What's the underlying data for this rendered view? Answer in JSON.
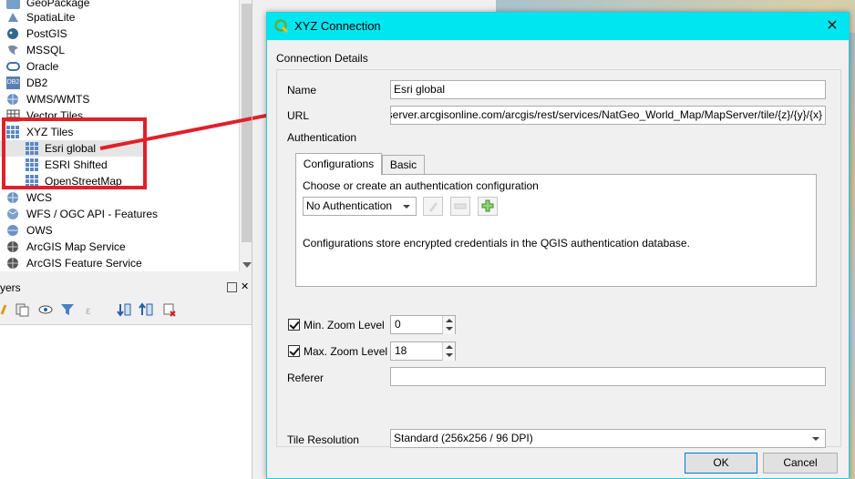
{
  "browser": {
    "items": [
      {
        "label": "GeoPackage",
        "icon": "geopackage-icon"
      },
      {
        "label": "SpatiaLite",
        "icon": "spatialite-icon"
      },
      {
        "label": "PostGIS",
        "icon": "postgis-icon"
      },
      {
        "label": "MSSQL",
        "icon": "mssql-icon"
      },
      {
        "label": "Oracle",
        "icon": "oracle-icon"
      },
      {
        "label": "DB2",
        "icon": "db2-icon"
      },
      {
        "label": "WMS/WMTS",
        "icon": "wms-icon"
      },
      {
        "label": "Vector Tiles",
        "icon": "vector-tiles-icon"
      },
      {
        "label": "XYZ Tiles",
        "icon": "xyz-tiles-icon"
      },
      {
        "label": "Esri global",
        "icon": "xyz-layer-icon"
      },
      {
        "label": "ESRI Shifted",
        "icon": "xyz-layer-icon"
      },
      {
        "label": "OpenStreetMap",
        "icon": "xyz-layer-icon"
      },
      {
        "label": "WCS",
        "icon": "wcs-icon"
      },
      {
        "label": "WFS / OGC API - Features",
        "icon": "wfs-icon"
      },
      {
        "label": "OWS",
        "icon": "ows-icon"
      },
      {
        "label": "ArcGIS Map Service",
        "icon": "arcgis-icon"
      },
      {
        "label": "ArcGIS Feature Service",
        "icon": "arcgis-icon"
      }
    ]
  },
  "layers": {
    "title": "yers"
  },
  "dialog": {
    "title": "XYZ Connection",
    "section": "Connection Details",
    "name_label": "Name",
    "name_value": "Esri global",
    "url_label": "URL",
    "url_value": "http://server.arcgisonline.com/arcgis/rest/services/NatGeo_World_Map/MapServer/tile/{z}/{y}/{x}",
    "auth_label": "Authentication",
    "tabs": [
      "Configurations",
      "Basic"
    ],
    "auth_prompt": "Choose or create an authentication configuration",
    "auth_select": "No Authentication",
    "auth_note": "Configurations store encrypted credentials in the QGIS authentication database.",
    "min_zoom_label": "Min. Zoom Level",
    "min_zoom_value": "0",
    "max_zoom_label": "Max. Zoom Level",
    "max_zoom_value": "18",
    "referer_label": "Referer",
    "referer_value": "",
    "tile_res_label": "Tile Resolution",
    "tile_res_value": "Standard (256x256 / 96 DPI)",
    "ok": "OK",
    "cancel": "Cancel"
  },
  "colors": {
    "titlebar": "#00e6f0",
    "highlight": "#e0202a",
    "tree_icon": "#5b88c6"
  }
}
